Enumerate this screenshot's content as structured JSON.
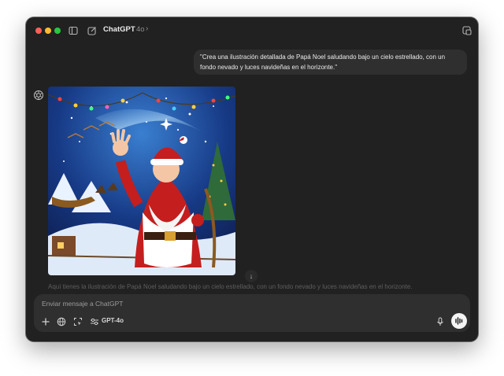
{
  "app": {
    "title": "ChatGPT",
    "model": "4o",
    "chevron": "›"
  },
  "colors": {
    "window_bg": "#212121",
    "bubble_bg": "#2f2f2f",
    "close": "#ff5f57",
    "minimize": "#febc2e",
    "zoom": "#28c840"
  },
  "icons": {
    "sidebar": "sidebar-toggle-icon",
    "new_chat": "new-chat-icon",
    "window": "new-window-icon",
    "assistant": "openai-logo-icon",
    "attach": "plus-icon",
    "web": "globe-icon",
    "tools": "screen-capture-icon",
    "model": "sliders-icon",
    "mic": "microphone-icon",
    "voice": "voice-mode-icon"
  },
  "conversation": {
    "user_message": "\"Crea una ilustración detallada de Papá Noel saludando bajo un cielo estrellado, con un fondo nevado y luces navideñas en el horizonte.\"",
    "assistant_text": "Aquí tienes la ilustración de Papá Noel saludando bajo un cielo estrellado, con un fondo nevado y luces navideñas en el horizonte.",
    "scroll_down": "↓"
  },
  "composer": {
    "placeholder": "Enviar mensaje a ChatGPT",
    "model_label": "GPT-4o"
  }
}
